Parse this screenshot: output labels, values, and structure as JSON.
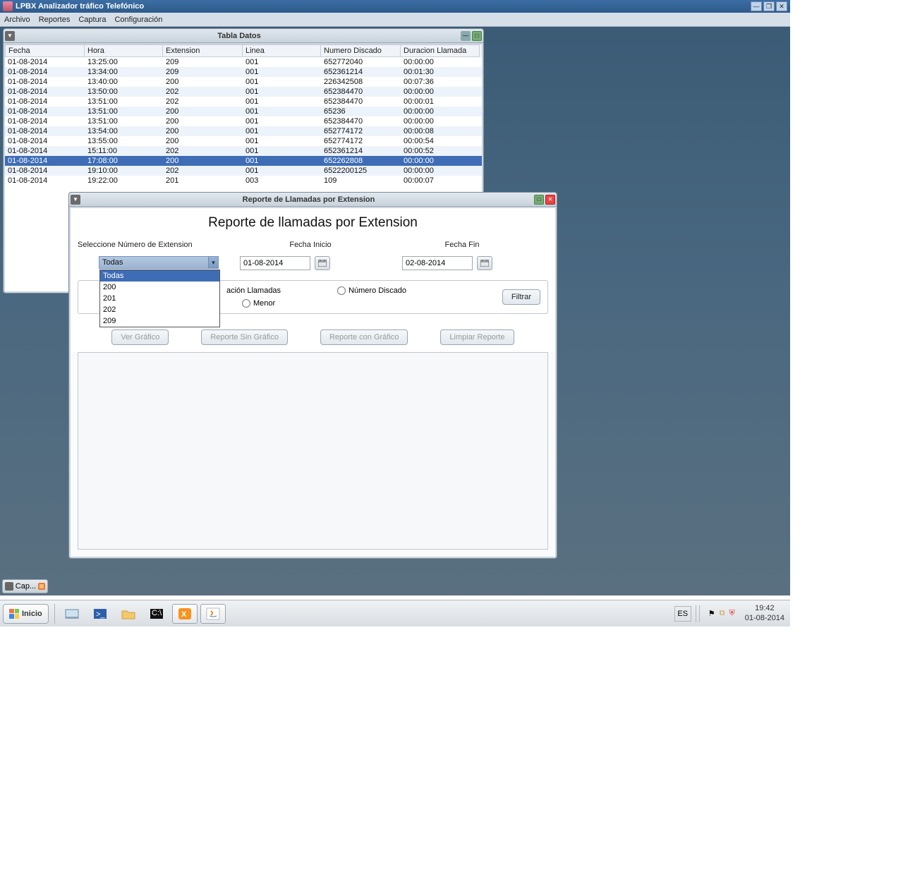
{
  "app": {
    "title": "LPBX Analizador tráfico Telefónico",
    "menus": [
      "Archivo",
      "Reportes",
      "Captura",
      "Configuración"
    ]
  },
  "table_frame": {
    "title": "Tabla Datos",
    "columns": [
      "Fecha",
      "Hora",
      "Extension",
      "Linea",
      "Numero Discado",
      "Duracion Llamada"
    ],
    "rows": [
      {
        "fecha": "01-08-2014",
        "hora": "13:25:00",
        "ext": "209",
        "lin": "001",
        "num": "652772040",
        "dur": "00:00:00"
      },
      {
        "fecha": "01-08-2014",
        "hora": "13:34:00",
        "ext": "209",
        "lin": "001",
        "num": "652361214",
        "dur": "00:01:30"
      },
      {
        "fecha": "01-08-2014",
        "hora": "13:40:00",
        "ext": "200",
        "lin": "001",
        "num": "226342508",
        "dur": "00:07:36"
      },
      {
        "fecha": "01-08-2014",
        "hora": "13:50:00",
        "ext": "202",
        "lin": "001",
        "num": "652384470",
        "dur": "00:00:00"
      },
      {
        "fecha": "01-08-2014",
        "hora": "13:51:00",
        "ext": "202",
        "lin": "001",
        "num": "652384470",
        "dur": "00:00:01"
      },
      {
        "fecha": "01-08-2014",
        "hora": "13:51:00",
        "ext": "200",
        "lin": "001",
        "num": "65236",
        "dur": "00:00:00"
      },
      {
        "fecha": "01-08-2014",
        "hora": "13:51:00",
        "ext": "200",
        "lin": "001",
        "num": "652384470",
        "dur": "00:00:00"
      },
      {
        "fecha": "01-08-2014",
        "hora": "13:54:00",
        "ext": "200",
        "lin": "001",
        "num": "652774172",
        "dur": "00:00:08"
      },
      {
        "fecha": "01-08-2014",
        "hora": "13:55:00",
        "ext": "200",
        "lin": "001",
        "num": "652774172",
        "dur": "00:00:54"
      },
      {
        "fecha": "01-08-2014",
        "hora": "15:11:00",
        "ext": "202",
        "lin": "001",
        "num": "652361214",
        "dur": "00:00:52"
      },
      {
        "fecha": "01-08-2014",
        "hora": "17:08:00",
        "ext": "200",
        "lin": "001",
        "num": "652262808",
        "dur": "00:00:00",
        "selected": true
      },
      {
        "fecha": "01-08-2014",
        "hora": "19:10:00",
        "ext": "202",
        "lin": "001",
        "num": "6522200125",
        "dur": "00:00:00"
      },
      {
        "fecha": "01-08-2014",
        "hora": "19:22:00",
        "ext": "201",
        "lin": "003",
        "num": "109",
        "dur": "00:00:07"
      }
    ]
  },
  "report_frame": {
    "title": "Reporte de Llamadas por  Extension",
    "header": "Reporte de llamadas por Extension",
    "label_ext": "Seleccione Número de Extension",
    "label_start": "Fecha Inicio",
    "label_end": "Fecha Fin",
    "combo_selected": "Todas",
    "combo_options": [
      "Todas",
      "200",
      "201",
      "202",
      "209"
    ],
    "date_start": "01-08-2014",
    "date_end": "02-08-2014",
    "radio_duracion": "ación Llamadas",
    "radio_numero": "Número Discado",
    "radio_menor": "Menor",
    "btn_filtrar": "Filtrar",
    "btn_grafico": "Ver Gráfico",
    "btn_sin": "Reporte Sin Gráfico",
    "btn_con": "Reporte con Gráfico",
    "btn_limpiar": "Limpiar Reporte"
  },
  "panel_box": "Cap...",
  "taskbar": {
    "start": "Inicio",
    "lang": "ES",
    "time": "19:42",
    "date": "01-08-2014"
  }
}
